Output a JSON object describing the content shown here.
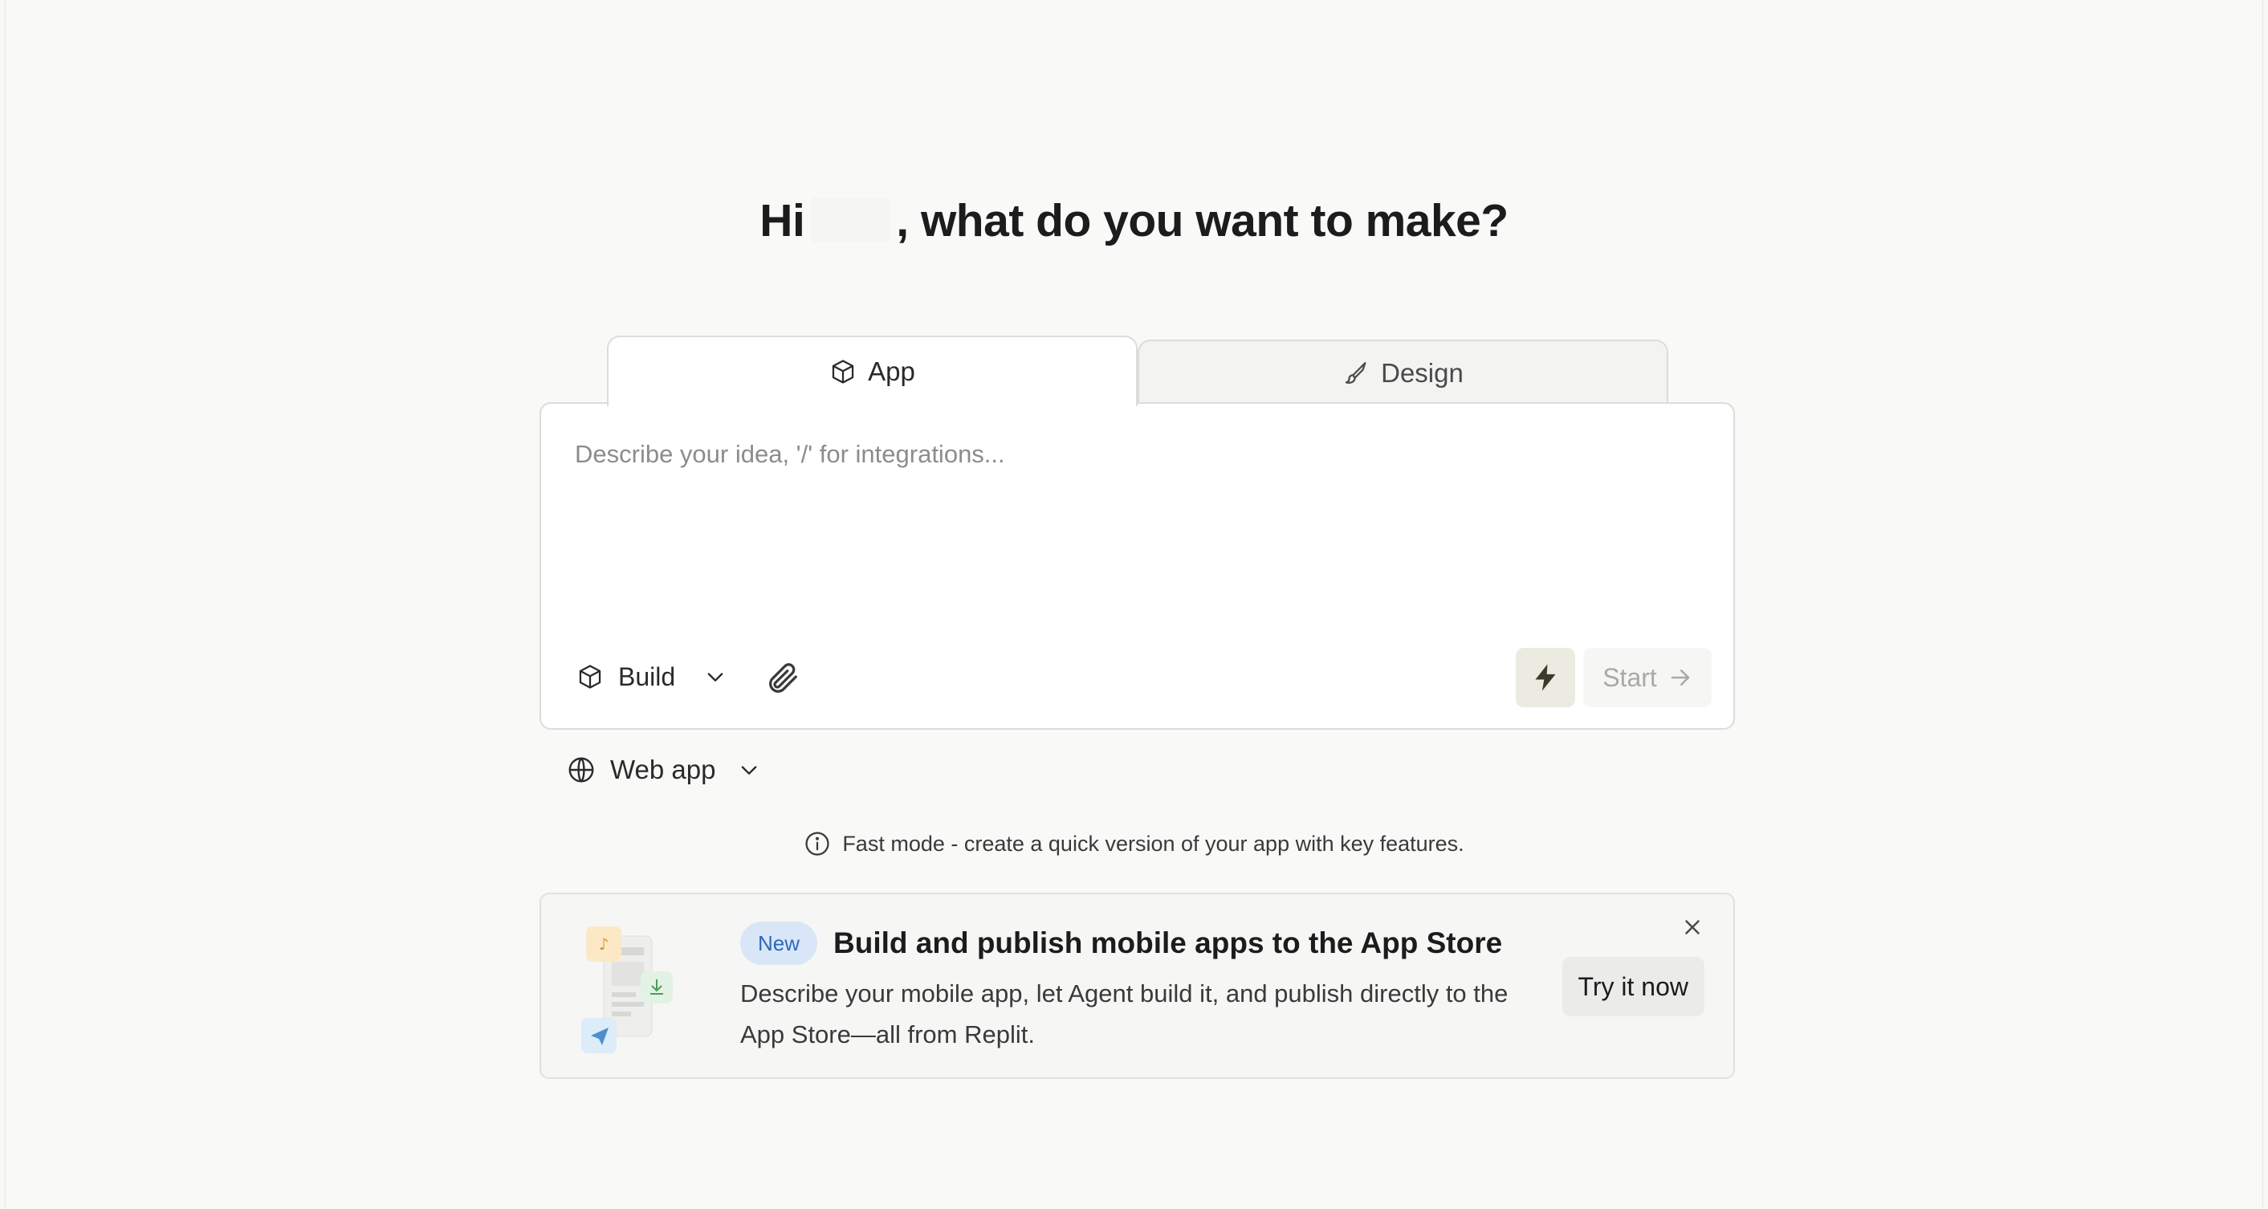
{
  "greeting": {
    "prefix": "Hi",
    "suffix": ", what do you want to make?"
  },
  "tabs": [
    {
      "label": "App",
      "icon": "cube-icon",
      "active": true
    },
    {
      "label": "Design",
      "icon": "brush-icon",
      "active": false
    }
  ],
  "composer": {
    "placeholder": "Describe your idea, '/' for integrations...",
    "mode_label": "Build",
    "start_label": "Start"
  },
  "platform": {
    "label": "Web app"
  },
  "info": {
    "text": "Fast mode - create a quick version of your app with key features."
  },
  "banner": {
    "badge": "New",
    "title": "Build and publish mobile apps to the App Store",
    "description": "Describe your mobile app, let Agent build it, and publish directly to the App Store—all from Replit.",
    "cta": "Try it now"
  },
  "colors": {
    "background": "#f9f9f8",
    "badge_bg": "#d9e6f8",
    "badge_text": "#2d69bd",
    "bolt_bg": "#ecebe2"
  }
}
